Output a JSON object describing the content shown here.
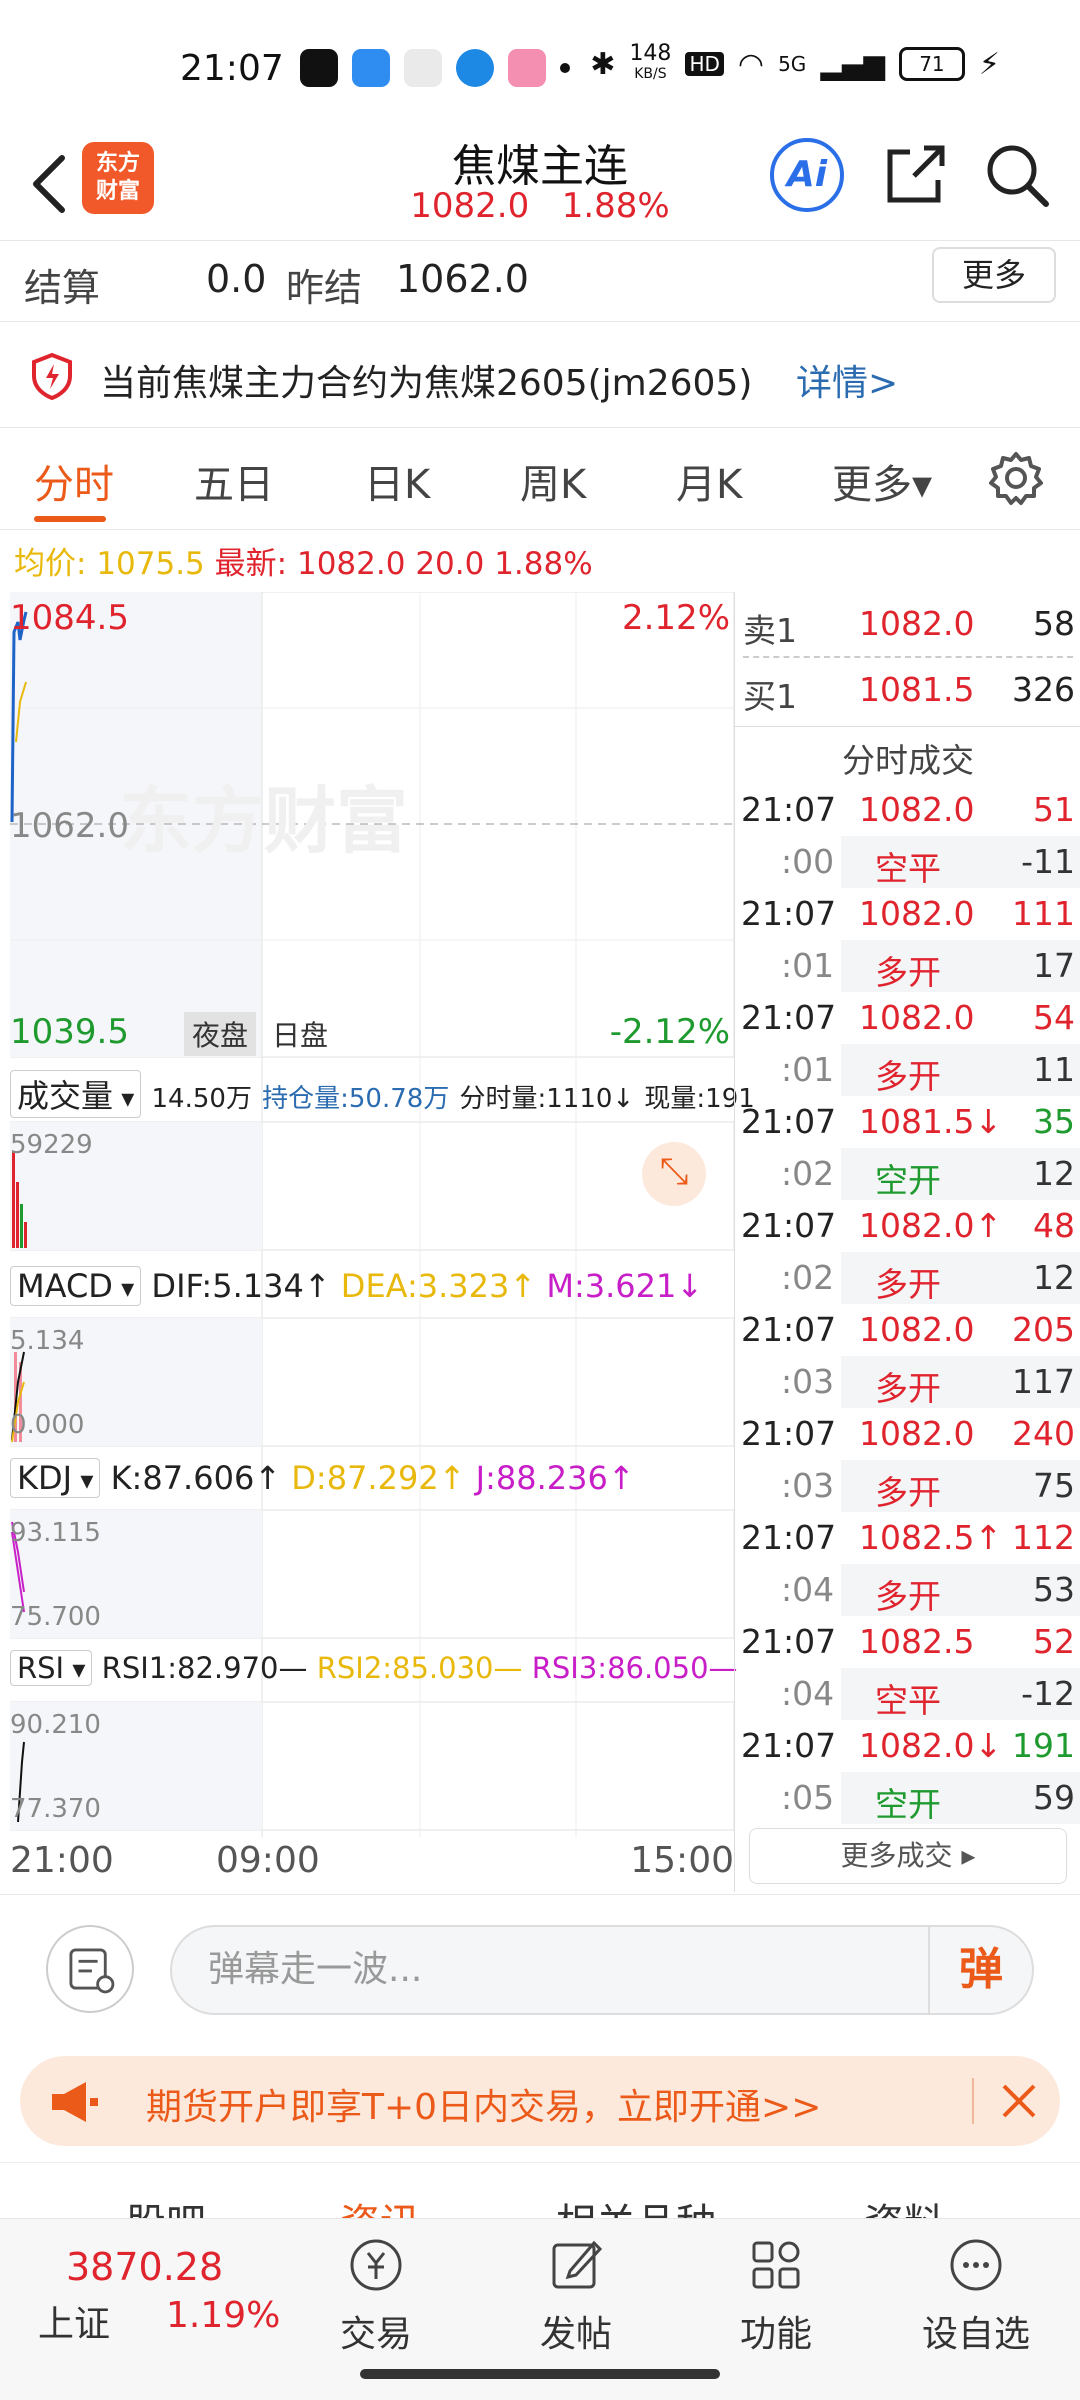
{
  "status_bar": {
    "time": "21:07",
    "net_speed": "148",
    "net_unit": "KB/S",
    "hd": "HD",
    "signal": "5G",
    "battery": "71"
  },
  "header": {
    "logo_line1": "东方",
    "logo_line2": "财富",
    "title": "焦煤主连",
    "price": "1082.0",
    "change_pct": "1.88%",
    "ai_label": "Ai"
  },
  "settle": {
    "label1": "结算",
    "value1": "0.0",
    "label2": "昨结",
    "value2": "1062.0",
    "more": "更多"
  },
  "notice": {
    "text": "当前焦煤主力合约为焦煤2605(jm2605)",
    "link": "详情>"
  },
  "tabs": [
    {
      "label": "分时"
    },
    {
      "label": "五日"
    },
    {
      "label": "日K"
    },
    {
      "label": "周K"
    },
    {
      "label": "月K"
    },
    {
      "label": "更多▾"
    }
  ],
  "avg_row": {
    "avg_label": "均价:",
    "avg_value": "1075.5",
    "latest_label": "最新:",
    "latest_value": "1082.0",
    "change": "20.0",
    "pct": "1.88%"
  },
  "price_chart": {
    "high": "1084.5",
    "high_pct": "2.12%",
    "mid": "1062.0",
    "low": "1039.5",
    "low_pct": "-2.12%",
    "night": "夜盘",
    "day": "日盘",
    "watermark": "东方财富"
  },
  "volume": {
    "label": "成交量",
    "total": "14.50万",
    "oi_label": "持仓量:50.78万",
    "minute_vol": "分时量:1110↓",
    "cur_vol": "现量:191",
    "axis": "59229"
  },
  "macd": {
    "label": "MACD",
    "dif": "DIF:5.134↑",
    "dea": "DEA:3.323↑",
    "m": "M:3.621↓",
    "top": "5.134",
    "bottom": "0.000"
  },
  "kdj": {
    "label": "KDJ",
    "k": "K:87.606↑",
    "d": "D:87.292↑",
    "j": "J:88.236↑",
    "top": "93.115",
    "bottom": "75.700"
  },
  "rsi": {
    "label": "RSI",
    "r1": "RSI1:82.970—",
    "r2": "RSI2:85.030—",
    "r3": "RSI3:86.050—",
    "top": "90.210",
    "bottom": "77.370"
  },
  "x_axis": {
    "start": "21:00",
    "mid": "09:00",
    "end": "15:00"
  },
  "order_book": {
    "ask_label": "卖1",
    "ask_price": "1082.0",
    "ask_vol": "58",
    "bid_label": "买1",
    "bid_price": "1081.5",
    "bid_vol": "326",
    "trades_title": "分时成交",
    "more_trades": "更多成交 ▸"
  },
  "trades": [
    {
      "time": "21:07",
      "price": "1082.0",
      "vol": "51",
      "vol_color": "red",
      "sec": ":00",
      "type": "空平",
      "type_color": "red",
      "oi": "-11"
    },
    {
      "time": "21:07",
      "price": "1082.0",
      "vol": "111",
      "vol_color": "red",
      "sec": ":01",
      "type": "多开",
      "type_color": "red",
      "oi": "17"
    },
    {
      "time": "21:07",
      "price": "1082.0",
      "vol": "54",
      "vol_color": "red",
      "sec": ":01",
      "type": "多开",
      "type_color": "red",
      "oi": "11"
    },
    {
      "time": "21:07",
      "price": "1081.5↓",
      "vol": "35",
      "vol_color": "green",
      "sec": ":02",
      "type": "空开",
      "type_color": "green",
      "oi": "12"
    },
    {
      "time": "21:07",
      "price": "1082.0↑",
      "vol": "48",
      "vol_color": "red",
      "sec": ":02",
      "type": "多开",
      "type_color": "red",
      "oi": "12"
    },
    {
      "time": "21:07",
      "price": "1082.0",
      "vol": "205",
      "vol_color": "red",
      "sec": ":03",
      "type": "多开",
      "type_color": "red",
      "oi": "117"
    },
    {
      "time": "21:07",
      "price": "1082.0",
      "vol": "240",
      "vol_color": "red",
      "sec": ":03",
      "type": "多开",
      "type_color": "red",
      "oi": "75"
    },
    {
      "time": "21:07",
      "price": "1082.5↑",
      "vol": "112",
      "vol_color": "red",
      "sec": ":04",
      "type": "多开",
      "type_color": "red",
      "oi": "53"
    },
    {
      "time": "21:07",
      "price": "1082.5",
      "vol": "52",
      "vol_color": "red",
      "sec": ":04",
      "type": "空平",
      "type_color": "red",
      "oi": "-12"
    },
    {
      "time": "21:07",
      "price": "1082.0↓",
      "vol": "191",
      "vol_color": "green",
      "sec": ":05",
      "type": "空开",
      "type_color": "green",
      "oi": "59"
    }
  ],
  "comment": {
    "placeholder": "弹幕走一波...",
    "send": "弹"
  },
  "promo": {
    "text": "期货开户即享T+0日内交易，立即开通>>"
  },
  "subtabs": [
    "股吧",
    "资讯",
    "相关品种",
    "资料"
  ],
  "bottom_nav": {
    "index_value": "3870.28",
    "index_name": "上证",
    "index_pct": "1.19%",
    "items": [
      {
        "label": "交易"
      },
      {
        "label": "发帖"
      },
      {
        "label": "功能"
      },
      {
        "label": "设自选"
      }
    ]
  },
  "colors": {
    "up": "#e0242e",
    "down": "#1f9a2e",
    "accent": "#ec5a1a",
    "link": "#2b6cb0"
  }
}
